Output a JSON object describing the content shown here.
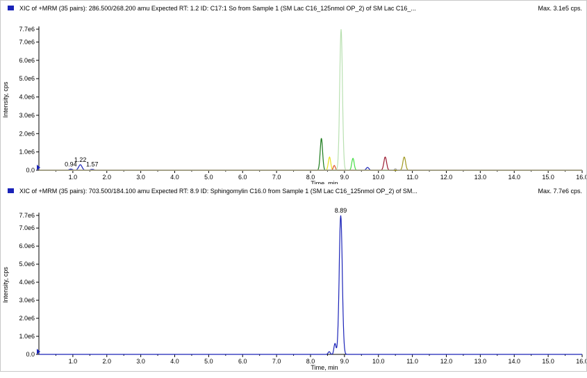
{
  "panels": [
    {
      "header": "XIC of +MRM (35 pairs): 286.500/268.200 amu Expected RT: 1.2 ID: C17:1 So from Sample 1 (SM Lac C16_125nmol OP_2) of SM Lac C16_...",
      "max_label": "Max. 3.1e5 cps."
    },
    {
      "header": "XIC of +MRM (35 pairs): 703.500/184.100 amu Expected RT: 8.9 ID: Sphingomylin C16.0 from Sample 1 (SM Lac C16_125nmol OP_2) of SM...",
      "max_label": "Max. 7.7e6 cps."
    }
  ],
  "chart_data": [
    {
      "type": "line",
      "xlabel": "Time, min",
      "ylabel": "Intensity, cps",
      "xlim": [
        0,
        16
      ],
      "ylim": [
        0,
        7700000.0
      ],
      "xticks": [
        "1.0",
        "2.0",
        "3.0",
        "4.0",
        "5.0",
        "6.0",
        "7.0",
        "8.0",
        "9.0",
        "10.0",
        "11.0",
        "12.0",
        "13.0",
        "14.0",
        "15.0",
        "16.0"
      ],
      "yticks": [
        "0.0",
        "1.0e6",
        "2.0e6",
        "3.0e6",
        "4.0e6",
        "5.0e6",
        "6.0e6",
        "7.0e6",
        "7.7e6"
      ],
      "series": [
        {
          "color": "#1a23b8",
          "peaks": [
            {
              "x": 0.94,
              "y": 60000,
              "w": 0.05
            },
            {
              "x": 1.22,
              "y": 300000,
              "w": 0.05
            },
            {
              "x": 1.57,
              "y": 50000,
              "w": 0.05
            },
            {
              "x": 9.68,
              "y": 150000,
              "w": 0.04
            }
          ]
        },
        {
          "color": "#1a7a1a",
          "peaks": [
            {
              "x": 8.32,
              "y": 1750000,
              "w": 0.035
            }
          ]
        },
        {
          "color": "#e8e020",
          "peaks": [
            {
              "x": 8.56,
              "y": 720000,
              "w": 0.035
            }
          ]
        },
        {
          "color": "#e0552a",
          "peaks": [
            {
              "x": 8.7,
              "y": 260000,
              "w": 0.03
            }
          ]
        },
        {
          "color": "#b8e0b0",
          "peaks": [
            {
              "x": 8.9,
              "y": 7700000,
              "w": 0.04
            }
          ]
        },
        {
          "color": "#44dd44",
          "peaks": [
            {
              "x": 9.25,
              "y": 650000,
              "w": 0.035
            }
          ]
        },
        {
          "color": "#9b1a30",
          "peaks": [
            {
              "x": 10.2,
              "y": 720000,
              "w": 0.04
            }
          ]
        },
        {
          "color": "#a09820",
          "peaks": [
            {
              "x": 10.76,
              "y": 720000,
              "w": 0.04
            }
          ]
        },
        {
          "color": "#aaaaaa",
          "peaks": [
            {
              "x": 10.5,
              "y": 80000,
              "w": 0.03
            }
          ]
        }
      ],
      "annotations": [
        {
          "x": 0.94,
          "y": 60000,
          "text": "0.94"
        },
        {
          "x": 1.22,
          "y": 300000,
          "text": "1.22"
        },
        {
          "x": 1.57,
          "y": 50000,
          "text": "1.57"
        }
      ]
    },
    {
      "type": "line",
      "xlabel": "Time, min",
      "ylabel": "Intensity, cps",
      "xlim": [
        0,
        16
      ],
      "ylim": [
        0,
        7700000.0
      ],
      "xticks": [
        "1.0",
        "2.0",
        "3.0",
        "4.0",
        "5.0",
        "6.0",
        "7.0",
        "8.0",
        "9.0",
        "10.0",
        "11.0",
        "12.0",
        "13.0",
        "14.0",
        "15.0",
        "16.0"
      ],
      "yticks": [
        "0.0",
        "1.0e6",
        "2.0e6",
        "3.0e6",
        "4.0e6",
        "5.0e6",
        "6.0e6",
        "7.0e6",
        "7.7e6"
      ],
      "series": [
        {
          "color": "#1a23b8",
          "peaks": [
            {
              "x": 8.89,
              "y": 7700000,
              "w": 0.045
            },
            {
              "x": 8.72,
              "y": 600000,
              "w": 0.03
            },
            {
              "x": 8.55,
              "y": 150000,
              "w": 0.03
            }
          ]
        }
      ],
      "annotations": [
        {
          "x": 8.89,
          "y": 7700000,
          "text": "8.89"
        }
      ]
    }
  ]
}
